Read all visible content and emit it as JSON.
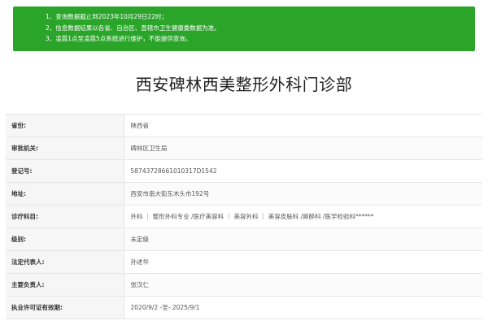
{
  "notice": {
    "lines": [
      "1、查询数据截止到2023年10月29日22时；",
      "2、信息数据结果以各省、自治区、直辖市卫生健康委数据为准。",
      "3、凌晨1点至凌晨5点系统进行维护，不能提供查询。"
    ]
  },
  "page_title": "西安碑林西美整形外科门诊部",
  "fields": [
    {
      "label": "省份:",
      "value": "陕西省"
    },
    {
      "label": "审批机关:",
      "value": "碑林区卫生局"
    },
    {
      "label": "登记号:",
      "value": "58743728661010317D1542"
    },
    {
      "label": "地址:",
      "value": "西安市南大街东木头市192号"
    },
    {
      "label": "诊疗科目:",
      "value": "外科 ｜ 整形外科专业 /医疗美容科 ｜ 美容外科 ｜ 美容皮肤科 /麻醉科 /医学检验科******"
    },
    {
      "label": "级别:",
      "value": "未定级"
    },
    {
      "label": "法定代表人:",
      "value": "孙述华"
    },
    {
      "label": "主要负责人:",
      "value": "张汉仁"
    },
    {
      "label": "执业许可证有效期:",
      "value": "2020/9/2 -至- 2025/9/1"
    }
  ],
  "colors": {
    "notice_bg": "#2aa52a",
    "label_bg": "#f6f6f6"
  }
}
